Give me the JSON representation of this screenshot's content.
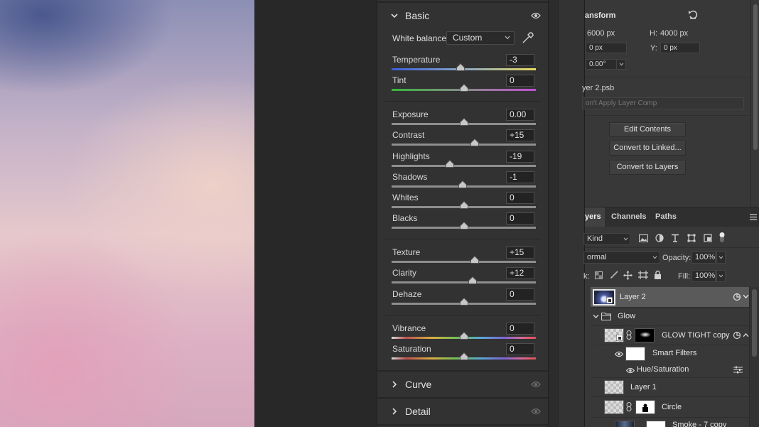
{
  "acr": {
    "basic": {
      "title": "Basic"
    },
    "white_balance": {
      "label": "White balance",
      "value": "Custom"
    },
    "sliders": [
      {
        "label": "Temperature",
        "value": "-3",
        "position": 0.48,
        "track": "temp"
      },
      {
        "label": "Tint",
        "value": "0",
        "position": 0.5,
        "track": "tint"
      },
      {
        "label": "Exposure",
        "value": "0.00",
        "position": 0.5,
        "track": "gray"
      },
      {
        "label": "Contrast",
        "value": "+15",
        "position": 0.575,
        "track": "gray"
      },
      {
        "label": "Highlights",
        "value": "-19",
        "position": 0.405,
        "track": "gray"
      },
      {
        "label": "Shadows",
        "value": "-1",
        "position": 0.495,
        "track": "gray"
      },
      {
        "label": "Whites",
        "value": "0",
        "position": 0.5,
        "track": "gray"
      },
      {
        "label": "Blacks",
        "value": "0",
        "position": 0.5,
        "track": "gray"
      },
      {
        "label": "Texture",
        "value": "+15",
        "position": 0.575,
        "track": "gray"
      },
      {
        "label": "Clarity",
        "value": "+12",
        "position": 0.56,
        "track": "gray"
      },
      {
        "label": "Dehaze",
        "value": "0",
        "position": 0.5,
        "track": "gray"
      },
      {
        "label": "Vibrance",
        "value": "0",
        "position": 0.5,
        "track": "spectrum"
      },
      {
        "label": "Saturation",
        "value": "0",
        "position": 0.5,
        "track": "spectrum"
      }
    ],
    "curve": {
      "title": "Curve"
    },
    "detail": {
      "title": "Detail"
    }
  },
  "properties": {
    "section_title": "ansform",
    "w_value": "6000 px",
    "h_label": "H:",
    "h_value": "4000 px",
    "x_value": "0 px",
    "y_label": "Y:",
    "y_value": "0 px",
    "angle_value": "0.00°",
    "file_name": "yer 2.psb",
    "layer_comp": "on't Apply Layer Comp",
    "buttons": {
      "edit": "Edit Contents",
      "linked": "Convert to Linked...",
      "layers": "Convert to Layers"
    }
  },
  "layers_panel": {
    "tabs": [
      "yers",
      "Channels",
      "Paths"
    ],
    "filter_kind": "Kind",
    "blend_mode": "ormal",
    "opacity_label": "Opacity:",
    "opacity_value": "100%",
    "lock_label": "k:",
    "fill_label": "Fill:",
    "fill_value": "100%",
    "layers": [
      {
        "name": "Layer 2"
      },
      {
        "name": "Glow"
      },
      {
        "name": "GLOW TIGHT copy"
      },
      {
        "name": "Smart Filters"
      },
      {
        "name": "Hue/Saturation"
      },
      {
        "name": "Layer 1"
      },
      {
        "name": "Circle"
      },
      {
        "name": "Smoke - 7 copy"
      }
    ]
  },
  "colors": {
    "panel_bg": "#323232",
    "props_bg": "#383838",
    "selected_layer": "#5a5a5a"
  }
}
